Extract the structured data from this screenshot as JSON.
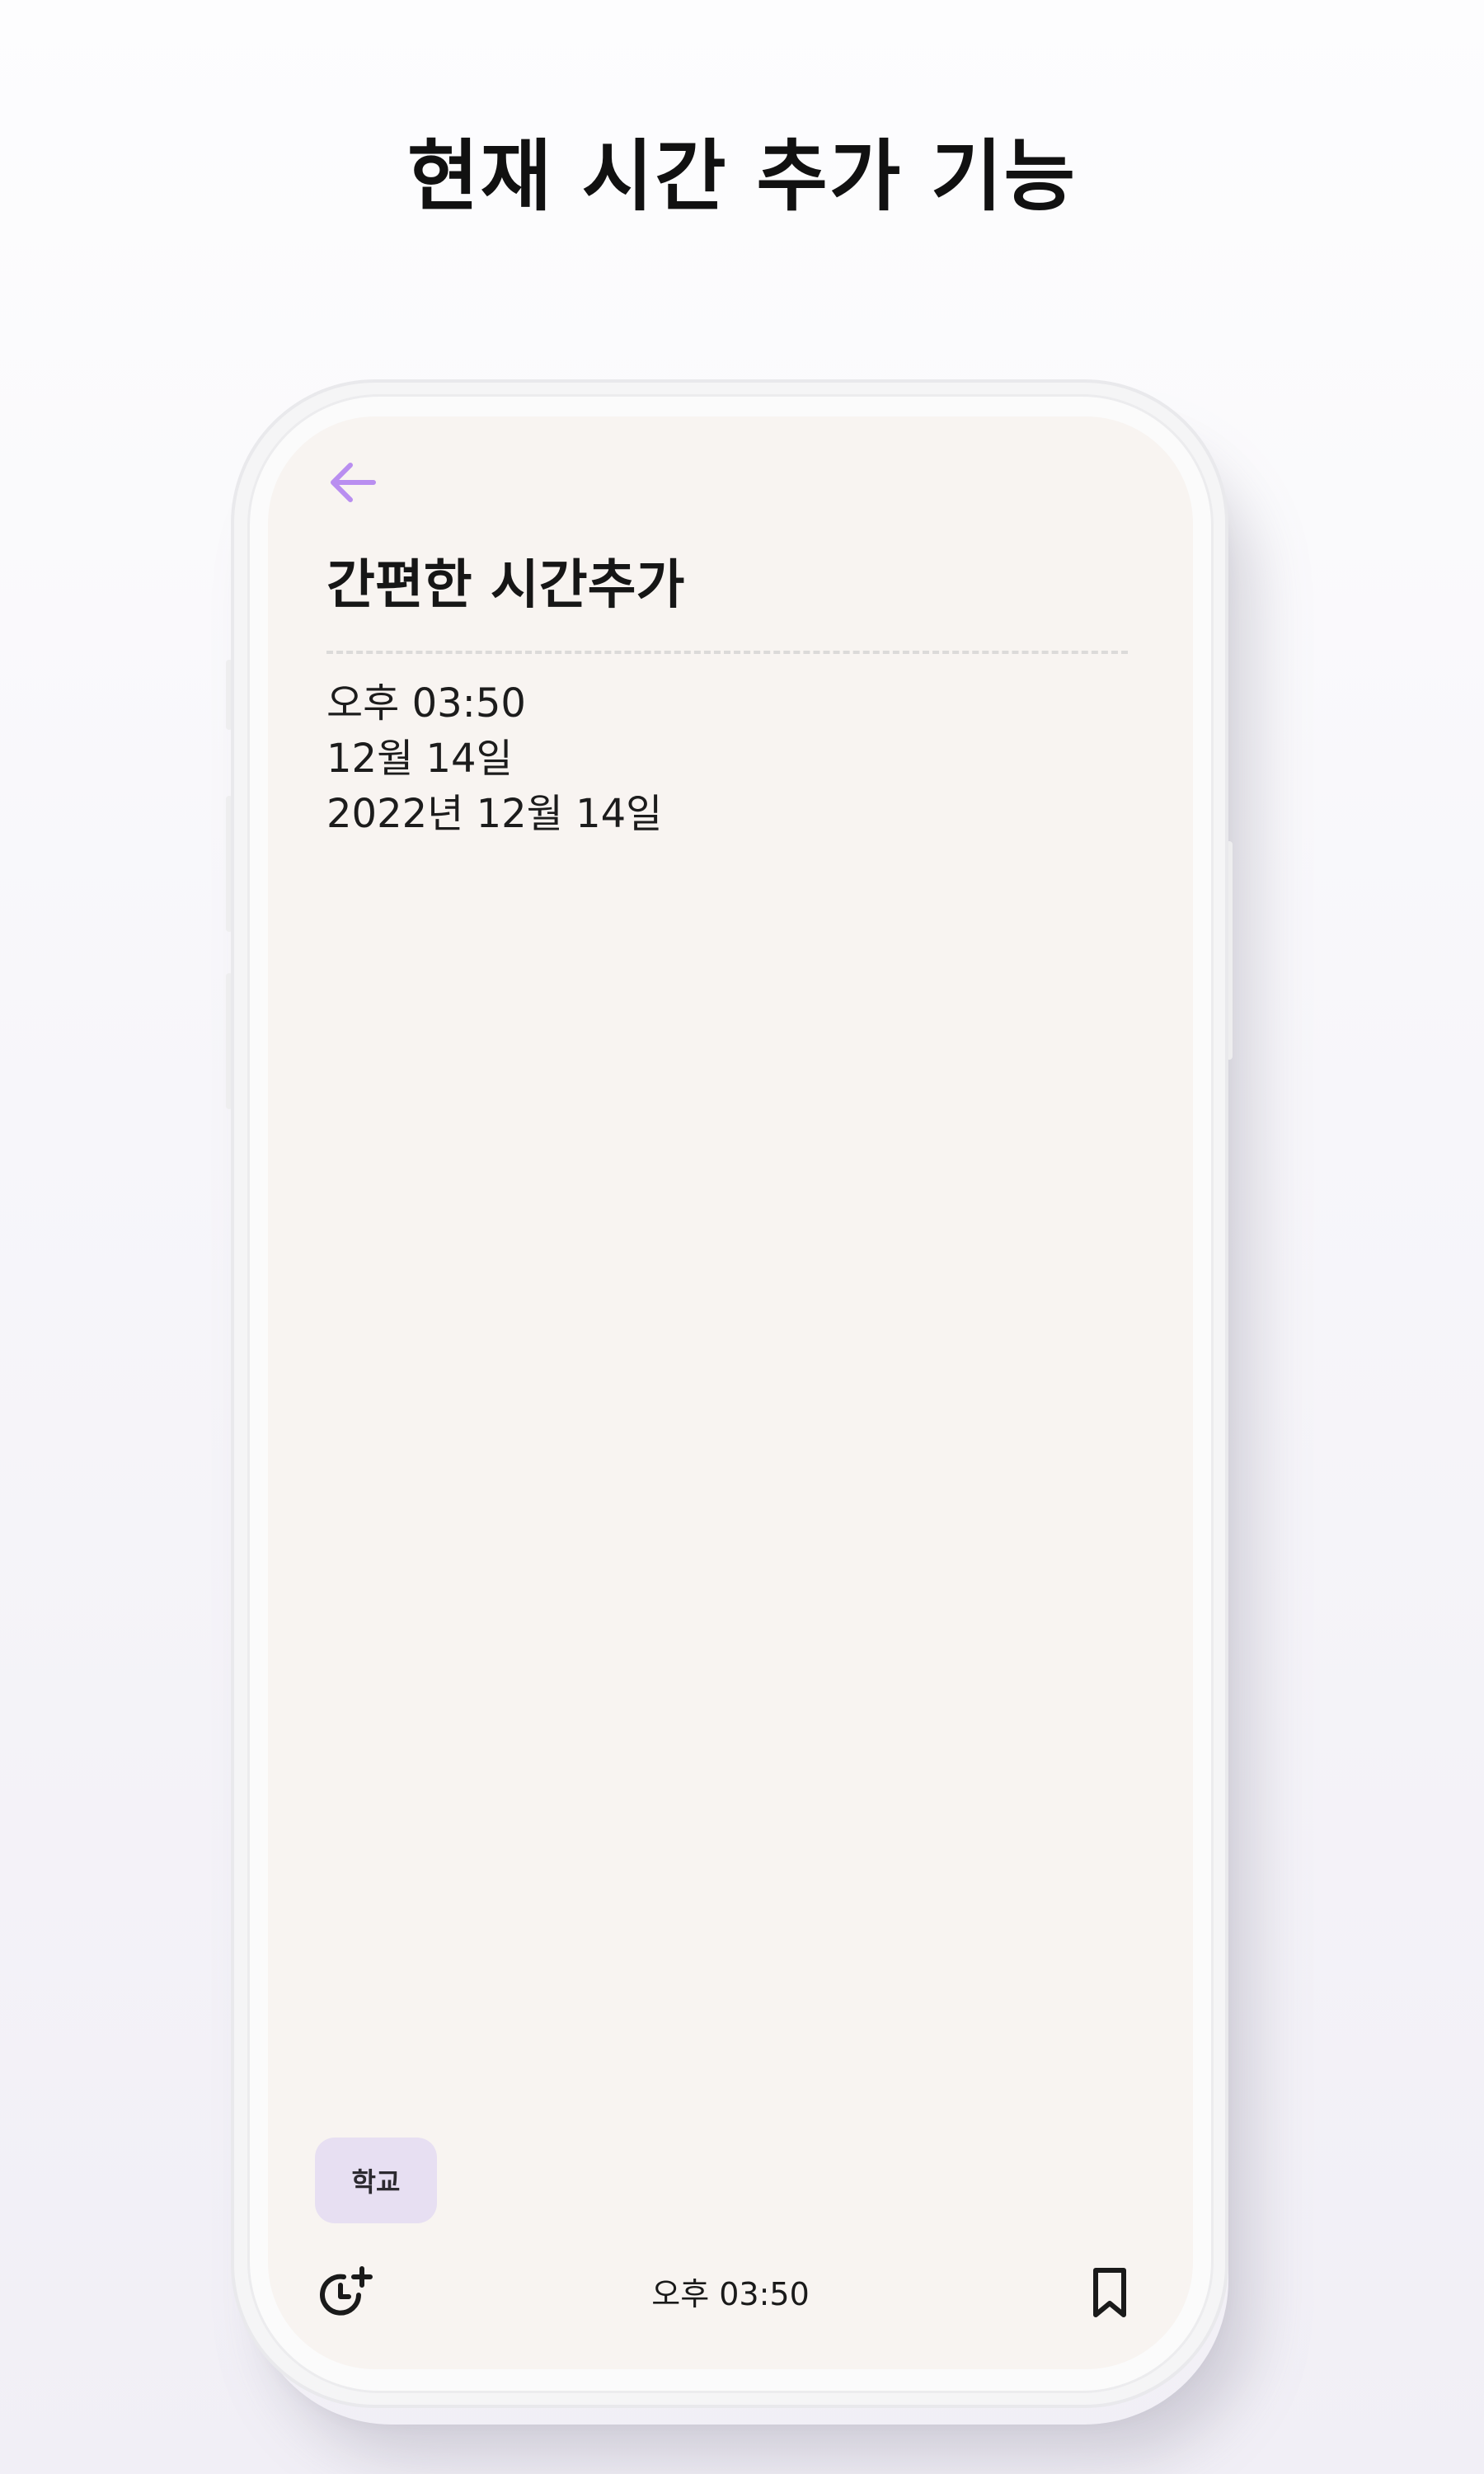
{
  "headline": "현재 시간 추가 기능",
  "note": {
    "title": "간편한 시간추가",
    "lines": [
      "오후 03:50",
      "12월 14일",
      "2022년 12월 14일"
    ]
  },
  "tag": {
    "label": "학교"
  },
  "bottom_bar": {
    "time_label": "오후 03:50"
  },
  "icons": {
    "back": "arrow-left-icon",
    "add_time": "clock-plus-icon",
    "bookmark": "bookmark-icon"
  },
  "colors": {
    "accent": "#b98ef0",
    "screen_background": "#f8f4f1",
    "tag_background": "#e7dff2",
    "text": "#161616"
  }
}
